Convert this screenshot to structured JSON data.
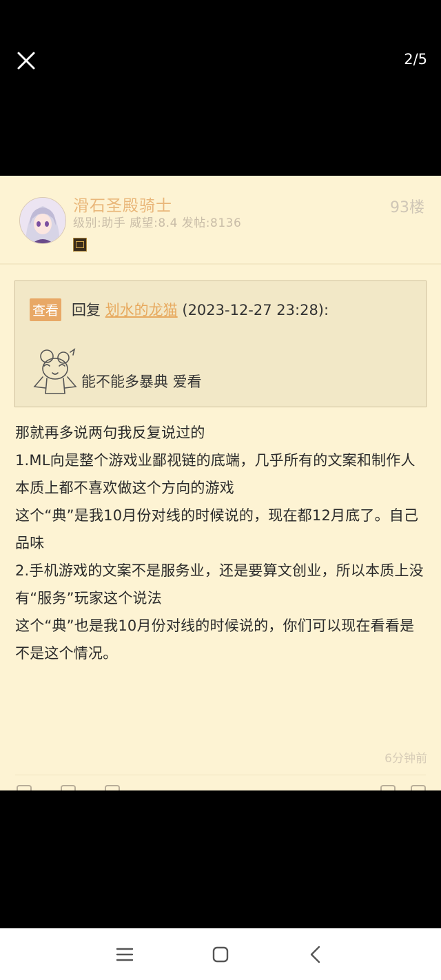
{
  "viewer": {
    "counter": "2/5"
  },
  "post": {
    "username": "滑石圣殿骑士",
    "user_meta": "级别:助手 威望:8.4 发帖:8136",
    "floor": "93楼",
    "quote": {
      "tag": "查看",
      "reply_label": "回复",
      "reply_to": "划水的龙猫",
      "reply_time": "(2023-12-27 23:28):",
      "text": "能不能多暴典 爱看"
    },
    "paragraphs": [
      "那就再多说两句我反复说过的",
      "",
      "1.ML向是整个游戏业鄙视链的底端，几乎所有的文案和制作人本质上都不喜欢做这个方向的游戏",
      "这个“典”是我10月份对线的时候说的，现在都12月底了。自己品味",
      "",
      "2.手机游戏的文案不是服务业，还是要算文创业，所以本质上没有“服务”玩家这个说法",
      "这个“典”也是我10月份对线的时候说的，你们可以现在看看是不是这个情况。"
    ],
    "time_ago": "6分钟前"
  },
  "colors": {
    "post_bg": "#fdf3d3",
    "username": "#e9b77a",
    "tag_bg": "#e8a866",
    "link": "#e7a95e"
  },
  "icons": {
    "close": "close-icon",
    "menu": "menu-icon",
    "home": "home-icon",
    "back": "back-icon"
  }
}
